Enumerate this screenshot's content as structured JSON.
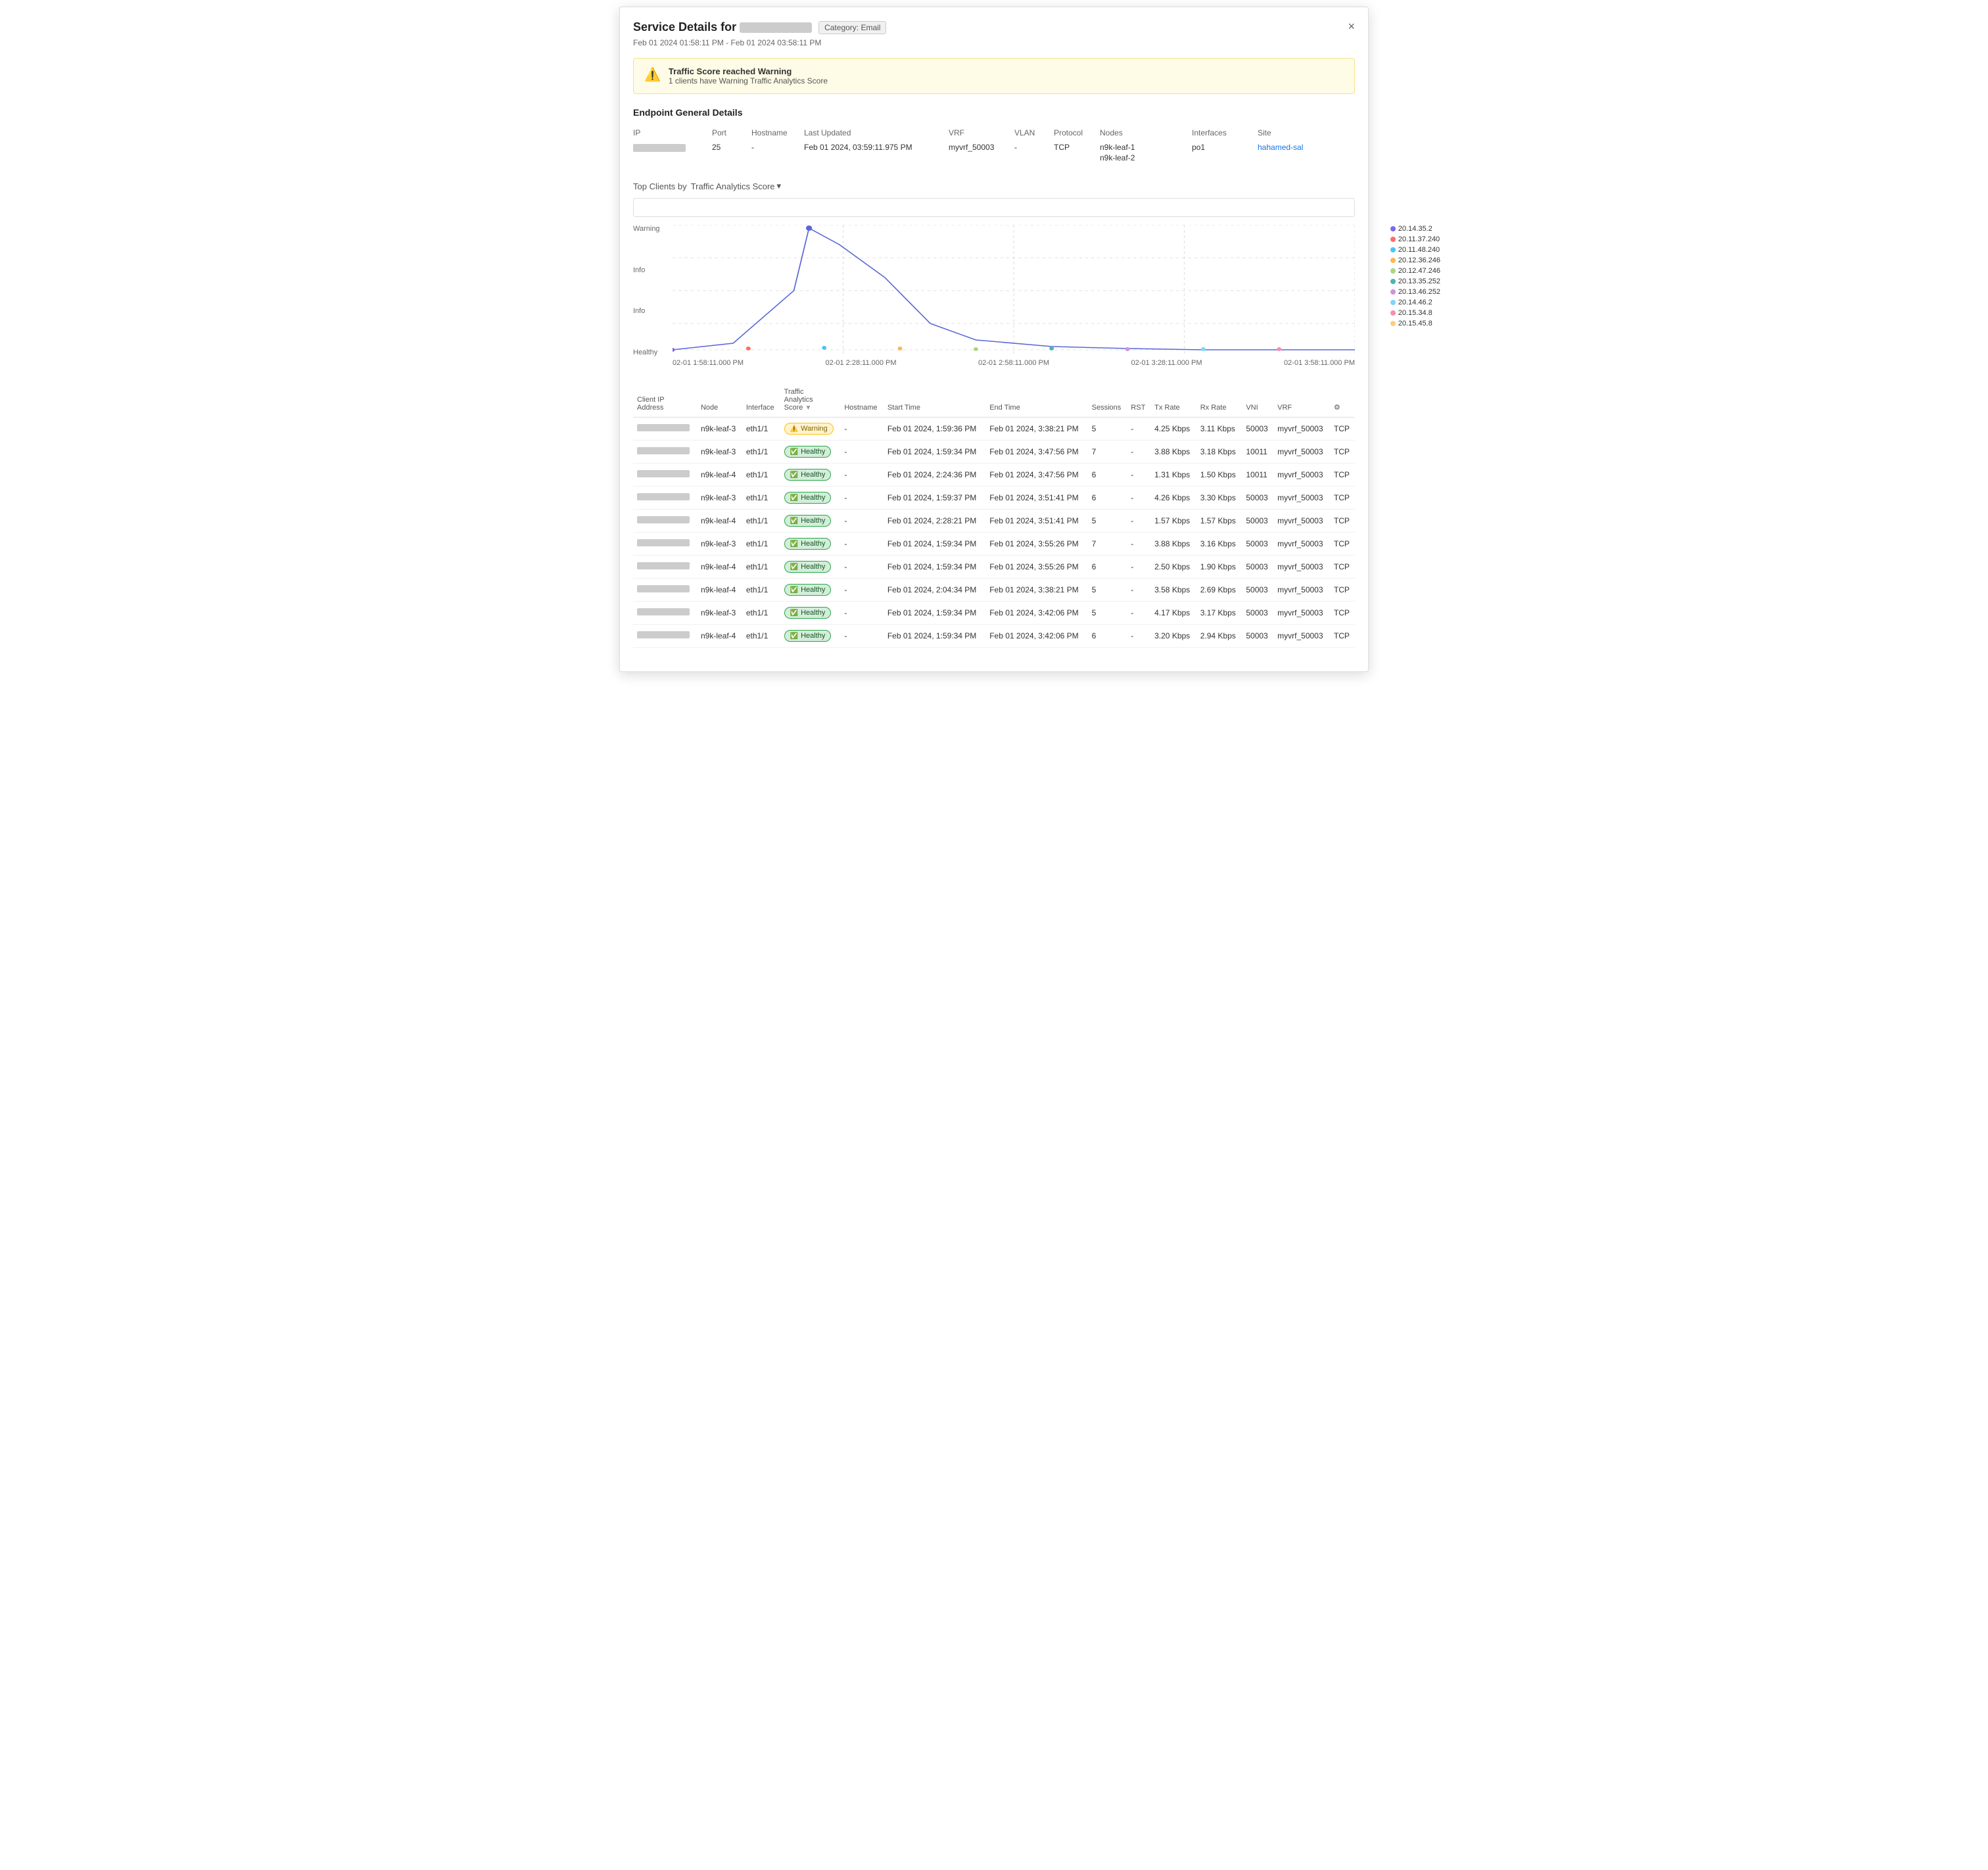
{
  "modal": {
    "title": "Service Details for",
    "ip_placeholder": "XX.XX.XX.XXX",
    "category_badge": "Category: Email",
    "subtitle": "Feb 01 2024 01:58:11 PM - Feb 01 2024 03:58:11 PM",
    "close_label": "×"
  },
  "warning_banner": {
    "title": "Traffic Score reached Warning",
    "description": "1 clients have Warning Traffic Analytics Score"
  },
  "endpoint_section": {
    "title": "Endpoint General Details",
    "headers": [
      "IP",
      "Port",
      "Hostname",
      "Last Updated",
      "VRF",
      "VLAN",
      "Protocol",
      "Nodes",
      "Interfaces",
      "Site"
    ],
    "values": {
      "ip": "",
      "port": "25",
      "hostname": "-",
      "last_updated": "Feb 01 2024, 03:59:11.975 PM",
      "vrf": "myvrf_50003",
      "vlan": "-",
      "protocol": "TCP",
      "nodes": [
        "n9k-leaf-1",
        "n9k-leaf-2"
      ],
      "interfaces": "po1",
      "site": "hahamed-sal"
    }
  },
  "top_clients": {
    "label": "Top Clients by",
    "filter_label": "Traffic Analytics Score",
    "search_placeholder": ""
  },
  "chart": {
    "y_labels": [
      "Warning",
      "",
      "Info",
      "",
      "Info",
      "",
      "Healthy"
    ],
    "x_labels": [
      "02-01 1:58:11.000 PM",
      "02-01 2:28:11.000 PM",
      "02-01 2:58:11.000 PM",
      "02-01 3:28:11.000 PM",
      "02-01 3:58:11.000 PM"
    ],
    "legend": [
      {
        "color": "#7B68EE",
        "label": "20.14.35.2"
      },
      {
        "color": "#FF6B6B",
        "label": "20.11.37.240"
      },
      {
        "color": "#4FC3F7",
        "label": "20.11.48.240"
      },
      {
        "color": "#FFB74D",
        "label": "20.12.36.246"
      },
      {
        "color": "#AED581",
        "label": "20.12.47.246"
      },
      {
        "color": "#4DB6AC",
        "label": "20.13.35.252"
      },
      {
        "color": "#CE93D8",
        "label": "20.13.46.252"
      },
      {
        "color": "#81D4FA",
        "label": "20.14.46.2"
      },
      {
        "color": "#F48FB1",
        "label": "20.15.34.8"
      },
      {
        "color": "#FFCC80",
        "label": "20.15.45.8"
      }
    ]
  },
  "table": {
    "headers": [
      "Client IP Address",
      "Node",
      "Interface",
      "Traffic Analytics Score",
      "Hostname",
      "Start Time",
      "End Time",
      "Sessions",
      "RST",
      "Tx Rate",
      "Rx Rate",
      "VNI",
      "VRF",
      "⚙"
    ],
    "rows": [
      {
        "ip": "",
        "node": "n9k-leaf-3",
        "interface": "eth1/1",
        "score": "Warning",
        "score_type": "warning",
        "hostname": "-",
        "start": "Feb 01 2024, 1:59:36 PM",
        "end": "Feb 01 2024, 3:38:21 PM",
        "sessions": "5",
        "rst": "-",
        "tx_rate": "4.25 Kbps",
        "rx_rate": "3.11 Kbps",
        "vni": "50003",
        "vrf": "myvrf_50003",
        "protocol": "TCP"
      },
      {
        "ip": "",
        "node": "n9k-leaf-3",
        "interface": "eth1/1",
        "score": "Healthy",
        "score_type": "healthy",
        "hostname": "-",
        "start": "Feb 01 2024, 1:59:34 PM",
        "end": "Feb 01 2024, 3:47:56 PM",
        "sessions": "7",
        "rst": "-",
        "tx_rate": "3.88 Kbps",
        "rx_rate": "3.18 Kbps",
        "vni": "10011",
        "vrf": "myvrf_50003",
        "protocol": "TCP"
      },
      {
        "ip": "",
        "node": "n9k-leaf-4",
        "interface": "eth1/1",
        "score": "Healthy",
        "score_type": "healthy",
        "hostname": "-",
        "start": "Feb 01 2024, 2:24:36 PM",
        "end": "Feb 01 2024, 3:47:56 PM",
        "sessions": "6",
        "rst": "-",
        "tx_rate": "1.31 Kbps",
        "rx_rate": "1.50 Kbps",
        "vni": "10011",
        "vrf": "myvrf_50003",
        "protocol": "TCP"
      },
      {
        "ip": "",
        "node": "n9k-leaf-3",
        "interface": "eth1/1",
        "score": "Healthy",
        "score_type": "healthy",
        "hostname": "-",
        "start": "Feb 01 2024, 1:59:37 PM",
        "end": "Feb 01 2024, 3:51:41 PM",
        "sessions": "6",
        "rst": "-",
        "tx_rate": "4.26 Kbps",
        "rx_rate": "3.30 Kbps",
        "vni": "50003",
        "vrf": "myvrf_50003",
        "protocol": "TCP"
      },
      {
        "ip": "",
        "node": "n9k-leaf-4",
        "interface": "eth1/1",
        "score": "Healthy",
        "score_type": "healthy",
        "hostname": "-",
        "start": "Feb 01 2024, 2:28:21 PM",
        "end": "Feb 01 2024, 3:51:41 PM",
        "sessions": "5",
        "rst": "-",
        "tx_rate": "1.57 Kbps",
        "rx_rate": "1.57 Kbps",
        "vni": "50003",
        "vrf": "myvrf_50003",
        "protocol": "TCP"
      },
      {
        "ip": "",
        "node": "n9k-leaf-3",
        "interface": "eth1/1",
        "score": "Healthy",
        "score_type": "healthy",
        "hostname": "-",
        "start": "Feb 01 2024, 1:59:34 PM",
        "end": "Feb 01 2024, 3:55:26 PM",
        "sessions": "7",
        "rst": "-",
        "tx_rate": "3.88 Kbps",
        "rx_rate": "3.16 Kbps",
        "vni": "50003",
        "vrf": "myvrf_50003",
        "protocol": "TCP"
      },
      {
        "ip": "",
        "node": "n9k-leaf-4",
        "interface": "eth1/1",
        "score": "Healthy",
        "score_type": "healthy",
        "hostname": "-",
        "start": "Feb 01 2024, 1:59:34 PM",
        "end": "Feb 01 2024, 3:55:26 PM",
        "sessions": "6",
        "rst": "-",
        "tx_rate": "2.50 Kbps",
        "rx_rate": "1.90 Kbps",
        "vni": "50003",
        "vrf": "myvrf_50003",
        "protocol": "TCP"
      },
      {
        "ip": "",
        "node": "n9k-leaf-4",
        "interface": "eth1/1",
        "score": "Healthy",
        "score_type": "healthy",
        "hostname": "-",
        "start": "Feb 01 2024, 2:04:34 PM",
        "end": "Feb 01 2024, 3:38:21 PM",
        "sessions": "5",
        "rst": "-",
        "tx_rate": "3.58 Kbps",
        "rx_rate": "2.69 Kbps",
        "vni": "50003",
        "vrf": "myvrf_50003",
        "protocol": "TCP"
      },
      {
        "ip": "",
        "node": "n9k-leaf-3",
        "interface": "eth1/1",
        "score": "Healthy",
        "score_type": "healthy",
        "hostname": "-",
        "start": "Feb 01 2024, 1:59:34 PM",
        "end": "Feb 01 2024, 3:42:06 PM",
        "sessions": "5",
        "rst": "-",
        "tx_rate": "4.17 Kbps",
        "rx_rate": "3.17 Kbps",
        "vni": "50003",
        "vrf": "myvrf_50003",
        "protocol": "TCP"
      },
      {
        "ip": "",
        "node": "n9k-leaf-4",
        "interface": "eth1/1",
        "score": "Healthy",
        "score_type": "healthy",
        "hostname": "-",
        "start": "Feb 01 2024, 1:59:34 PM",
        "end": "Feb 01 2024, 3:42:06 PM",
        "sessions": "6",
        "rst": "-",
        "tx_rate": "3.20 Kbps",
        "rx_rate": "2.94 Kbps",
        "vni": "50003",
        "vrf": "myvrf_50003",
        "protocol": "TCP"
      }
    ]
  }
}
